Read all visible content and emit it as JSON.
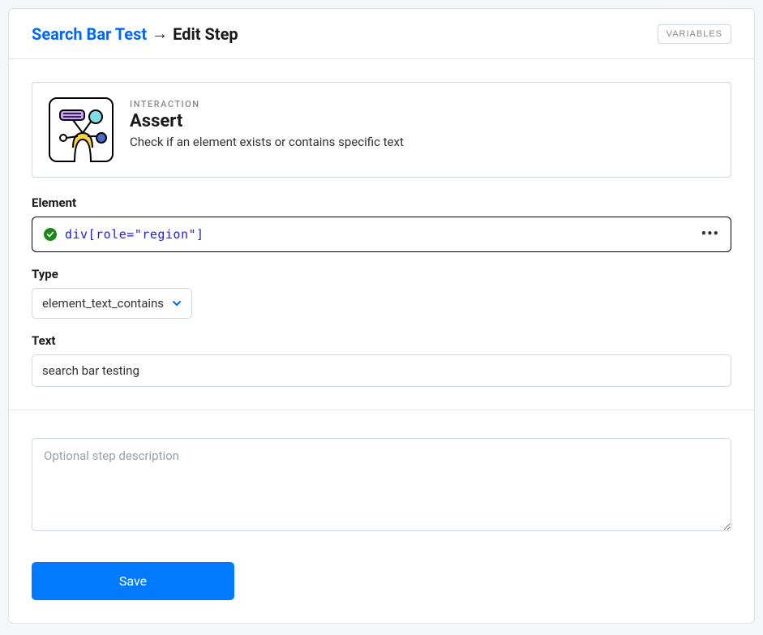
{
  "breadcrumb": {
    "parent": "Search Bar Test",
    "arrow": "→",
    "current": "Edit Step"
  },
  "header": {
    "variables_button": "VARIABLES"
  },
  "interaction": {
    "label": "INTERACTION",
    "title": "Assert",
    "description": "Check if an element exists or contains specific text"
  },
  "fields": {
    "element": {
      "label": "Element",
      "value": "div[role=\"region\"]"
    },
    "type": {
      "label": "Type",
      "value": "element_text_contains"
    },
    "text": {
      "label": "Text",
      "value": "search bar testing"
    }
  },
  "footer": {
    "description_placeholder": "Optional step description",
    "description_value": "",
    "save_button": "Save"
  }
}
